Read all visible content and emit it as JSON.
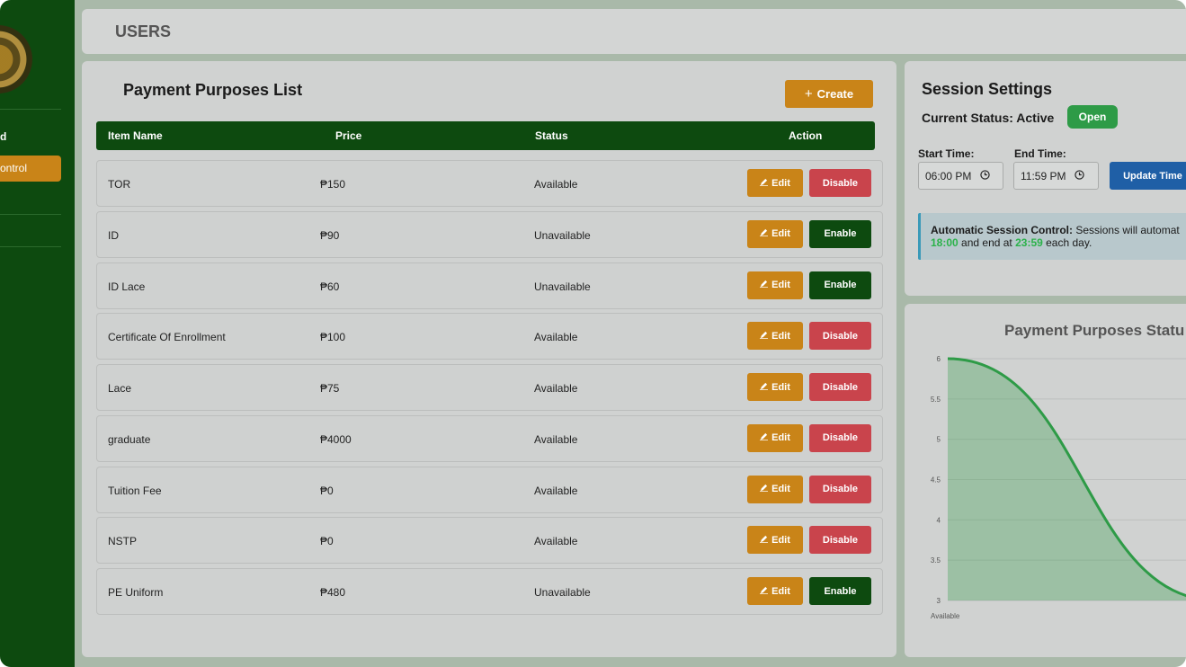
{
  "sidebar": {
    "items": [
      {
        "label": "d"
      },
      {
        "label": "ontrol",
        "active": true
      }
    ]
  },
  "header": {
    "title": "USERS"
  },
  "list": {
    "title": "Payment Purposes List",
    "create_label": "Create",
    "columns": [
      "Item Name",
      "Price",
      "Status",
      "Action"
    ],
    "edit_label": "Edit",
    "rows": [
      {
        "name": "TOR",
        "price": "₱150",
        "status": "Available",
        "toggle": "Disable"
      },
      {
        "name": "ID",
        "price": "₱90",
        "status": "Unavailable",
        "toggle": "Enable"
      },
      {
        "name": "ID Lace",
        "price": "₱60",
        "status": "Unavailable",
        "toggle": "Enable"
      },
      {
        "name": "Certificate Of Enrollment",
        "price": "₱100",
        "status": "Available",
        "toggle": "Disable"
      },
      {
        "name": "Lace",
        "price": "₱75",
        "status": "Available",
        "toggle": "Disable"
      },
      {
        "name": "graduate",
        "price": "₱4000",
        "status": "Available",
        "toggle": "Disable"
      },
      {
        "name": "Tuition Fee",
        "price": "₱0",
        "status": "Available",
        "toggle": "Disable"
      },
      {
        "name": "NSTP",
        "price": "₱0",
        "status": "Available",
        "toggle": "Disable"
      },
      {
        "name": "PE Uniform",
        "price": "₱480",
        "status": "Unavailable",
        "toggle": "Enable"
      }
    ]
  },
  "session": {
    "title": "Session Settings",
    "status_text": "Current Status: Active",
    "badge": "Open",
    "start_label": "Start Time:",
    "start_value": "06:00 PM",
    "end_label": "End Time:",
    "end_value": "11:59 PM",
    "update_label": "Update Time",
    "info_bold": "Automatic Session Control:",
    "info_text": " Sessions will automat",
    "info_start": "18:00",
    "info_mid": " and end at ",
    "info_end": "23:59",
    "info_tail": " each day."
  },
  "colors": {
    "sidebar": "#0d4a0f",
    "accent": "#c98418",
    "danger": "#c9444c",
    "primary": "#1f5fa6",
    "success": "#2e9b47"
  },
  "chart_data": {
    "type": "area",
    "title": "Payment Purposes Statu",
    "categories": [
      "Available"
    ],
    "series": [
      {
        "x": [
          0,
          1
        ],
        "values": [
          6,
          3
        ]
      }
    ],
    "ylim": [
      3,
      6
    ],
    "yticks": [
      "6",
      "5.5",
      "5",
      "4.5",
      "4",
      "3.5",
      "3"
    ],
    "grid": true
  }
}
